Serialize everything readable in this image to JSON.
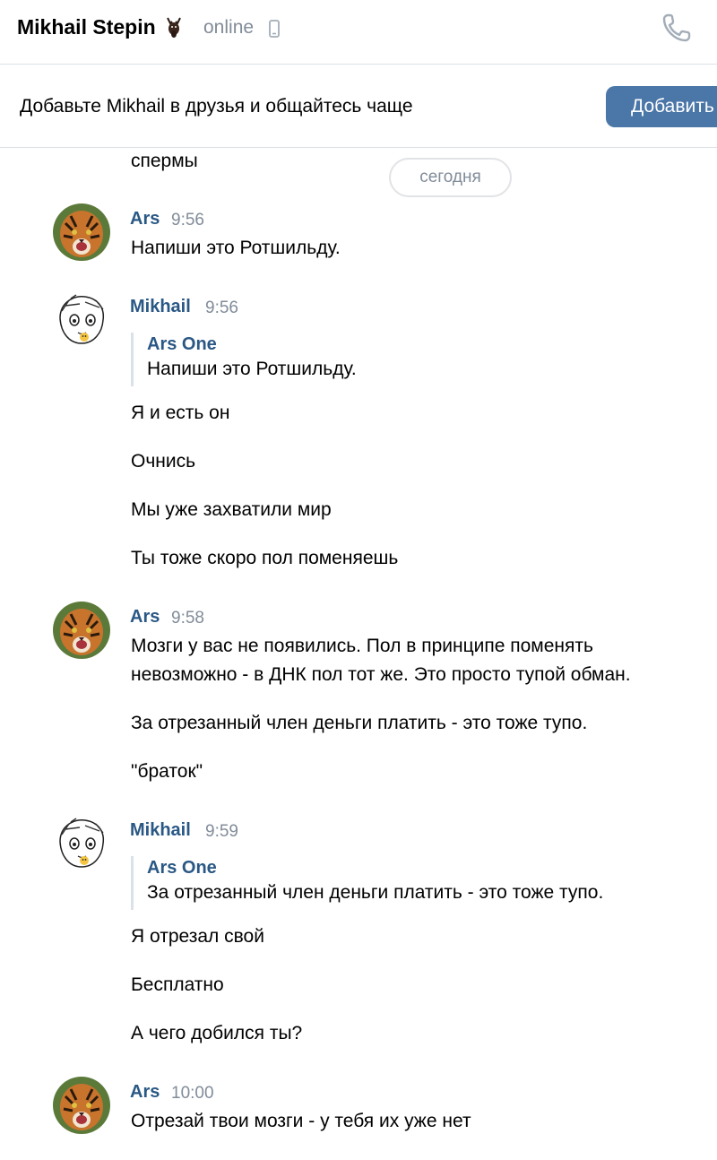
{
  "header": {
    "contact_name": "Mikhail Stepin",
    "status": "online",
    "icons": [
      "deer-emoji-icon",
      "mobile-phone-icon",
      "phone-call-icon"
    ]
  },
  "friend_banner": {
    "text": "Добавьте Mikhail в друзья и общайтесь чаще",
    "button_label": "Добавить"
  },
  "chat": {
    "partial_previous_text": "спермы",
    "date_separator": "сегодня",
    "messages": [
      {
        "author": "Ars",
        "time": "9:56",
        "avatar": "tiger-avatar",
        "lines": [
          "Напиши это Ротшильду."
        ]
      },
      {
        "author": "Mikhail",
        "time": "9:56",
        "avatar": "anime-sketch-avatar",
        "quote": {
          "author": "Ars One",
          "text": "Напиши это Ротшильду."
        },
        "lines": [
          "Я и есть он",
          "Очнись",
          "Мы уже захватили мир",
          "Ты тоже скоро пол поменяешь"
        ]
      },
      {
        "author": "Ars",
        "time": "9:58",
        "avatar": "tiger-avatar",
        "lines": [
          "Мозги у вас не появились. Пол в принципе поменять",
          "невозможно - в ДНК пол тот же. Это просто тупой обман.",
          "За отрезанный член деньги платить - это тоже тупо.",
          "\"браток\""
        ]
      },
      {
        "author": "Mikhail",
        "time": "9:59",
        "avatar": "anime-sketch-avatar",
        "quote": {
          "author": "Ars One",
          "text": "За отрезанный член деньги платить - это тоже тупо."
        },
        "lines": [
          "Я отрезал свой",
          "Бесплатно",
          "А чего добился ты?"
        ]
      },
      {
        "author": "Ars",
        "time": "10:00",
        "avatar": "tiger-avatar",
        "lines": [
          "Отрезай твои мозги - у тебя их уже нет"
        ]
      }
    ]
  },
  "colors": {
    "link_blue": "#2a5885",
    "button_blue": "#4a76a8",
    "muted_gray": "#818c99",
    "divider": "#dce1e6"
  }
}
